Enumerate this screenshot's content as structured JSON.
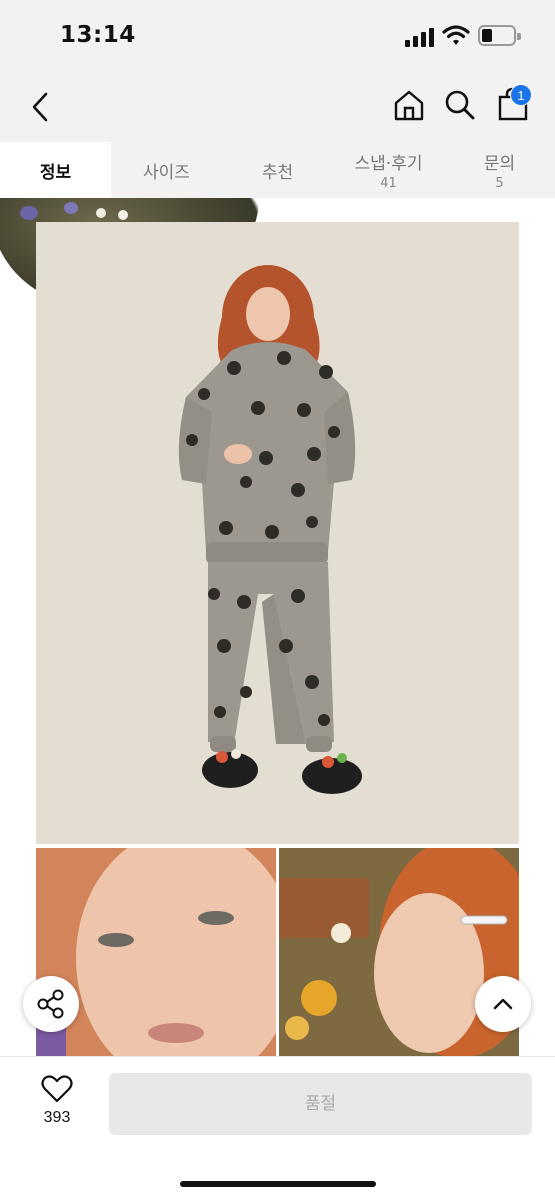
{
  "status_bar": {
    "time": "13:14"
  },
  "nav": {
    "cart_count": "1"
  },
  "tabs": [
    {
      "label": "정보",
      "count": ""
    },
    {
      "label": "사이즈",
      "count": ""
    },
    {
      "label": "추천",
      "count": ""
    },
    {
      "label": "스냅·후기",
      "count": "41"
    },
    {
      "label": "문의",
      "count": "5"
    }
  ],
  "bottom_bar": {
    "like_count": "393",
    "buy_label": "품절"
  },
  "colors": {
    "accent": "#1a73e8",
    "tab_bg": "#f2f2f2",
    "disabled_button": "#e8e8e8"
  },
  "icons": [
    "back-icon",
    "home-icon",
    "search-icon",
    "shopping-bag-icon",
    "share-icon",
    "chevron-up-icon",
    "heart-icon"
  ]
}
